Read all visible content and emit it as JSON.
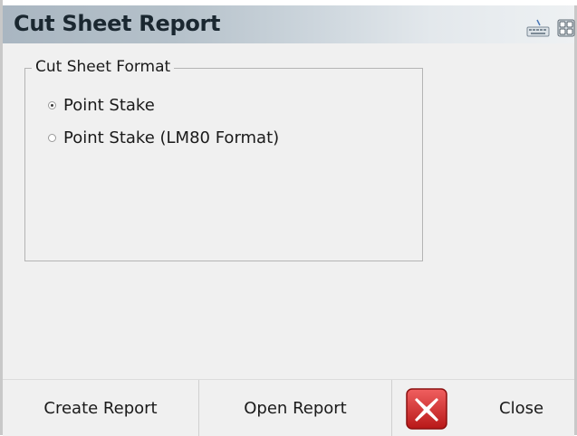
{
  "window": {
    "title": "Cut Sheet Report"
  },
  "titlebar_icons": [
    "keyboard-icon",
    "layout-icon"
  ],
  "format_group": {
    "legend": "Cut Sheet Format",
    "options": [
      {
        "label": "Point Stake",
        "selected": true
      },
      {
        "label": "Point Stake (LM80 Format)",
        "selected": false
      }
    ]
  },
  "buttons": {
    "create_report": "Create Report",
    "open_report": "Open Report",
    "close": "Close"
  },
  "colors": {
    "close_icon_red": "#d42a2a",
    "title_text": "#1a2730"
  }
}
